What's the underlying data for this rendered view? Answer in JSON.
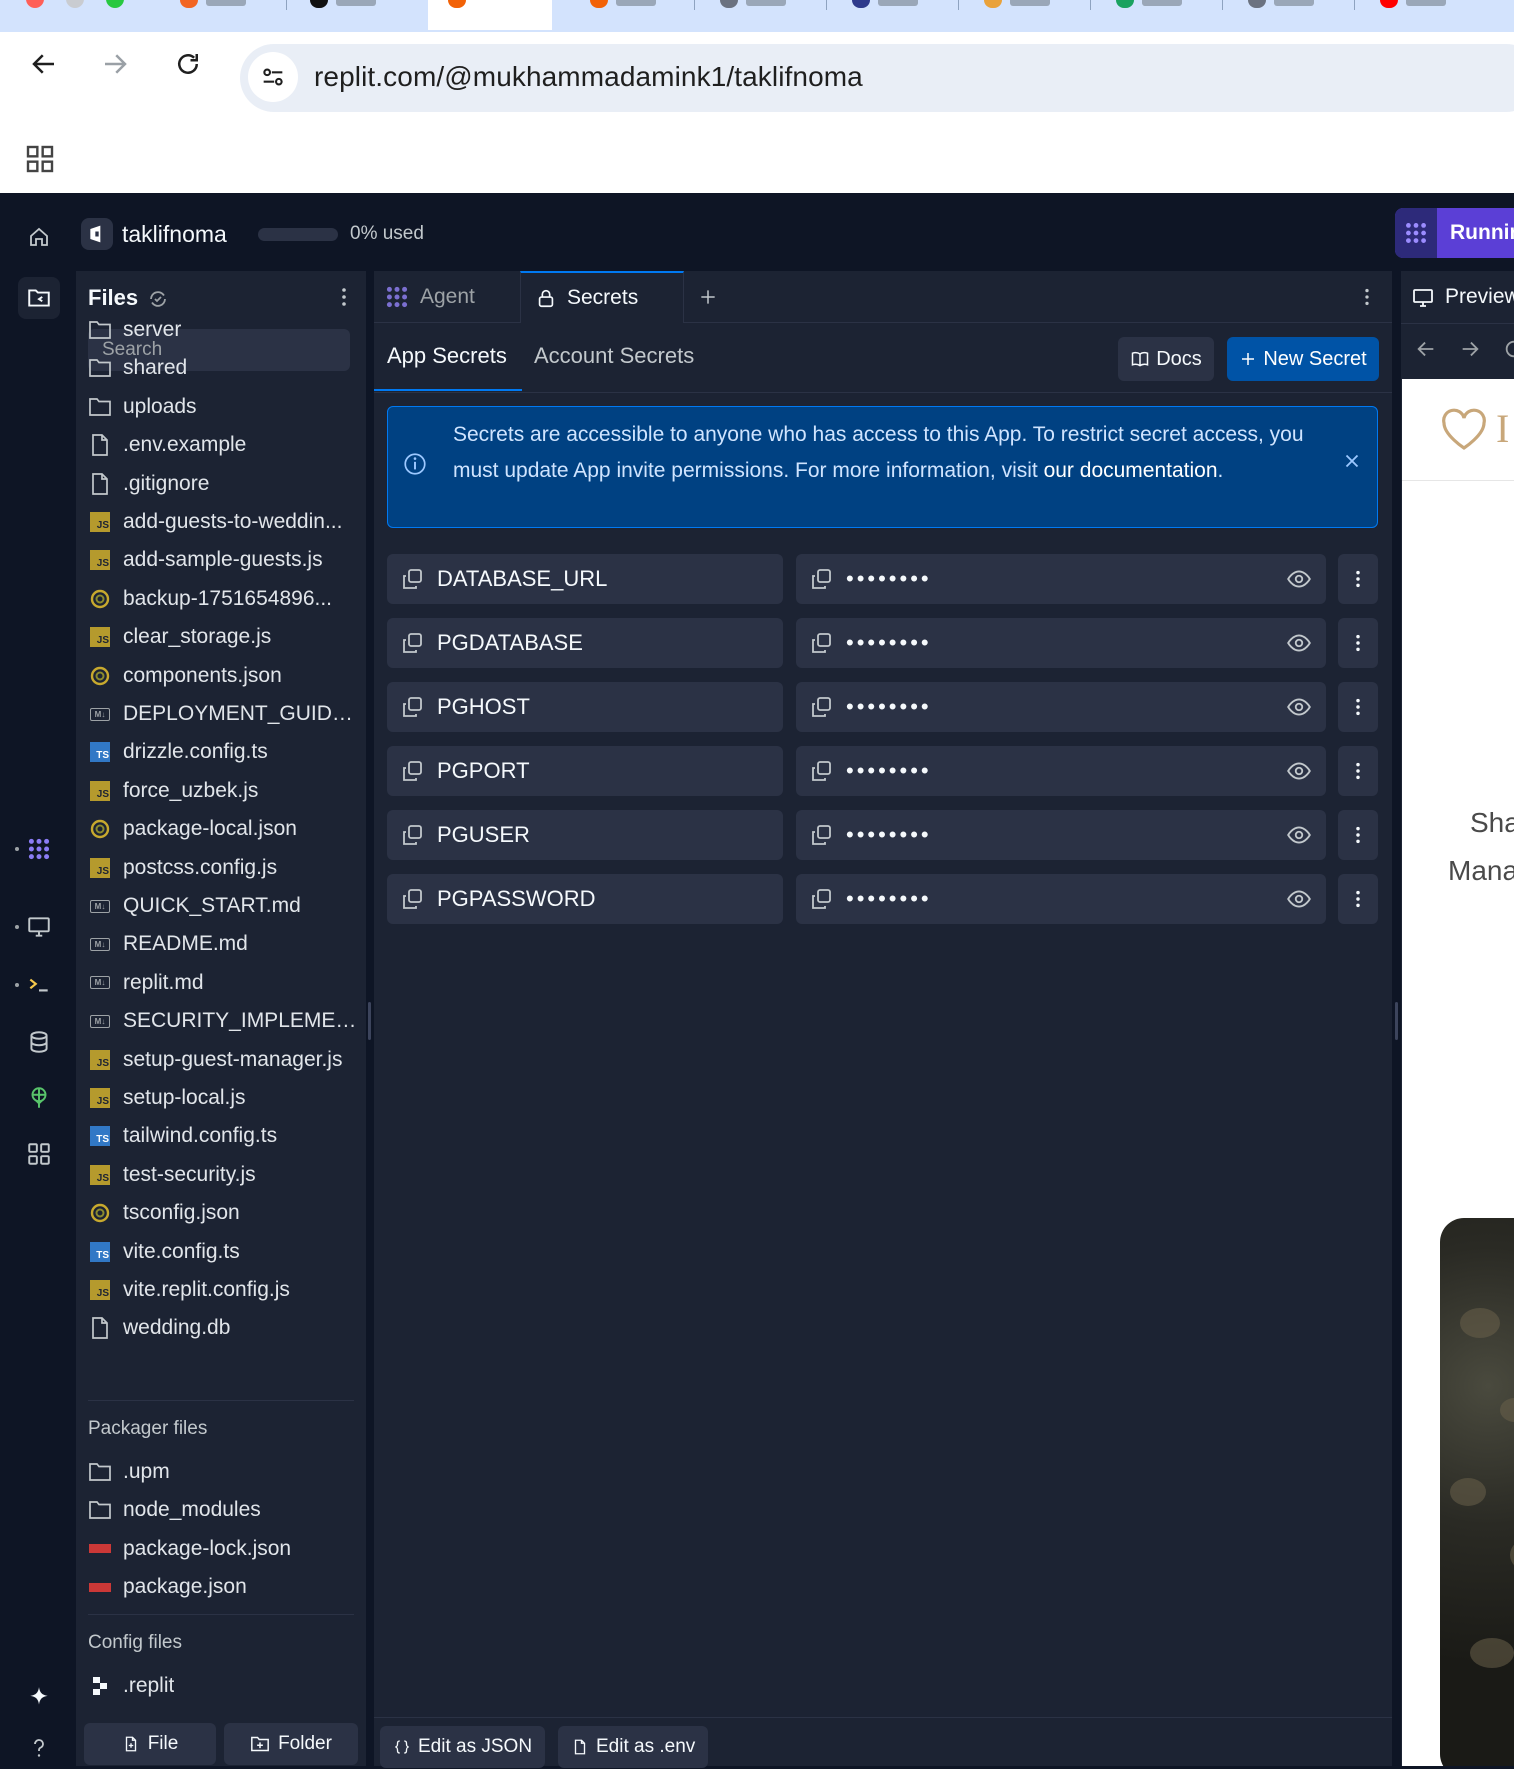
{
  "browser": {
    "url": "replit.com/@mukhammadamink1/taklifnoma"
  },
  "workspace": {
    "app_name": "taklifnoma",
    "usage": "0% used",
    "run_button": "Running",
    "usage_fraction": 0
  },
  "files": {
    "title": "Files",
    "search_placeholder": "Search",
    "items": [
      {
        "name": "server",
        "type": "folder"
      },
      {
        "name": "shared",
        "type": "folder"
      },
      {
        "name": "uploads",
        "type": "folder"
      },
      {
        "name": ".env.example",
        "type": "file"
      },
      {
        "name": ".gitignore",
        "type": "file"
      },
      {
        "name": "add-guests-to-weddin...",
        "type": "js"
      },
      {
        "name": "add-sample-guests.js",
        "type": "js"
      },
      {
        "name": "backup-1751654896...",
        "type": "json"
      },
      {
        "name": "clear_storage.js",
        "type": "js"
      },
      {
        "name": "components.json",
        "type": "json"
      },
      {
        "name": "DEPLOYMENT_GUIDE....",
        "type": "md"
      },
      {
        "name": "drizzle.config.ts",
        "type": "ts"
      },
      {
        "name": "force_uzbek.js",
        "type": "js"
      },
      {
        "name": "package-local.json",
        "type": "json"
      },
      {
        "name": "postcss.config.js",
        "type": "js"
      },
      {
        "name": "QUICK_START.md",
        "type": "md"
      },
      {
        "name": "README.md",
        "type": "md"
      },
      {
        "name": "replit.md",
        "type": "md"
      },
      {
        "name": "SECURITY_IMPLEMEN...",
        "type": "md"
      },
      {
        "name": "setup-guest-manager.js",
        "type": "js"
      },
      {
        "name": "setup-local.js",
        "type": "js"
      },
      {
        "name": "tailwind.config.ts",
        "type": "ts"
      },
      {
        "name": "test-security.js",
        "type": "js"
      },
      {
        "name": "tsconfig.json",
        "type": "json"
      },
      {
        "name": "vite.config.ts",
        "type": "ts"
      },
      {
        "name": "vite.replit.config.js",
        "type": "js"
      },
      {
        "name": "wedding.db",
        "type": "file"
      }
    ],
    "packager_label": "Packager files",
    "packager_items": [
      {
        "name": ".upm",
        "type": "folder"
      },
      {
        "name": "node_modules",
        "type": "folder"
      },
      {
        "name": "package-lock.json",
        "type": "npm"
      },
      {
        "name": "package.json",
        "type": "npm"
      }
    ],
    "config_label": "Config files",
    "config_items": [
      {
        "name": ".replit",
        "type": "replit"
      }
    ],
    "footer": {
      "file_button": "File",
      "folder_button": "Folder"
    }
  },
  "tabs": [
    {
      "label": "Agent",
      "active": false
    },
    {
      "label": "Secrets",
      "active": true
    }
  ],
  "secrets": {
    "subtabs": [
      "App Secrets",
      "Account Secrets"
    ],
    "active_subtab": "App Secrets",
    "docs_button": "Docs",
    "new_button": "New Secret",
    "info_text": "Secrets are accessible to anyone who has access to this App. To restrict secret access, you must update App invite permissions. For more information, visit ",
    "info_link": "our documentation",
    "info_period": ".",
    "rows": [
      {
        "key": "DATABASE_URL",
        "value": "••••••••"
      },
      {
        "key": "PGDATABASE",
        "value": "••••••••"
      },
      {
        "key": "PGHOST",
        "value": "••••••••"
      },
      {
        "key": "PGPORT",
        "value": "••••••••"
      },
      {
        "key": "PGUSER",
        "value": "••••••••"
      },
      {
        "key": "PGPASSWORD",
        "value": "••••••••"
      }
    ],
    "edit_json": "Edit as JSON",
    "edit_env": "Edit as .env"
  },
  "preview": {
    "title": "Preview",
    "logo_text": "I",
    "line1": "Sha",
    "line2": "Mana"
  },
  "colors": {
    "accent_blue": "#0079f2",
    "button_blue": "#0053a6",
    "run_purple": "#5b3fd6",
    "panel_bg": "#1c2333",
    "app_bg": "#0e1525"
  }
}
